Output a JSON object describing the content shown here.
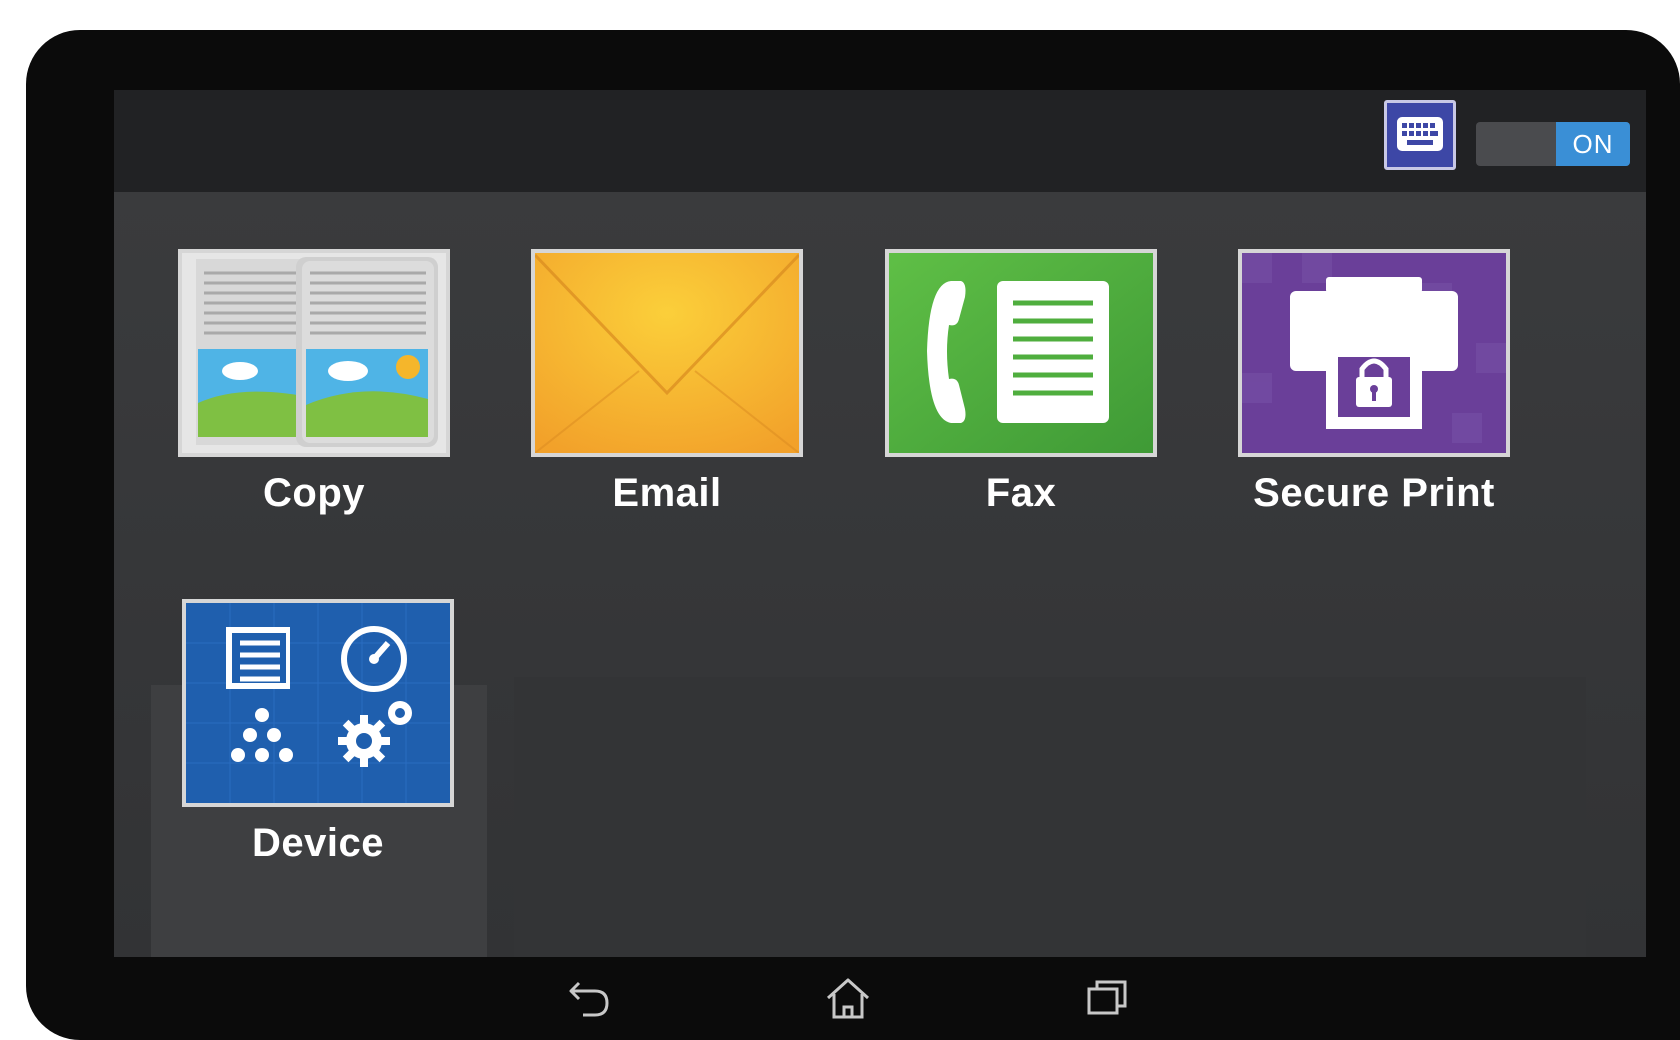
{
  "status_bar": {
    "keyboard_icon": "keyboard-icon",
    "toggle_label": "ON",
    "toggle_color": "#3a8fd6"
  },
  "apps": [
    {
      "label": "Copy",
      "icon": "copy-icon",
      "color": "#e8e8e8"
    },
    {
      "label": "Email",
      "icon": "envelope-icon",
      "color": "#f6b533"
    },
    {
      "label": "Fax",
      "icon": "fax-icon",
      "color": "#4fae3e"
    },
    {
      "label": "Secure Print",
      "icon": "secure-printer-icon",
      "color": "#6a3f99"
    },
    {
      "label": "Device",
      "icon": "device-settings-icon",
      "color": "#1f5fae"
    }
  ],
  "nav": {
    "back_icon": "back-icon",
    "home_icon": "home-icon",
    "recents_icon": "recents-icon"
  }
}
